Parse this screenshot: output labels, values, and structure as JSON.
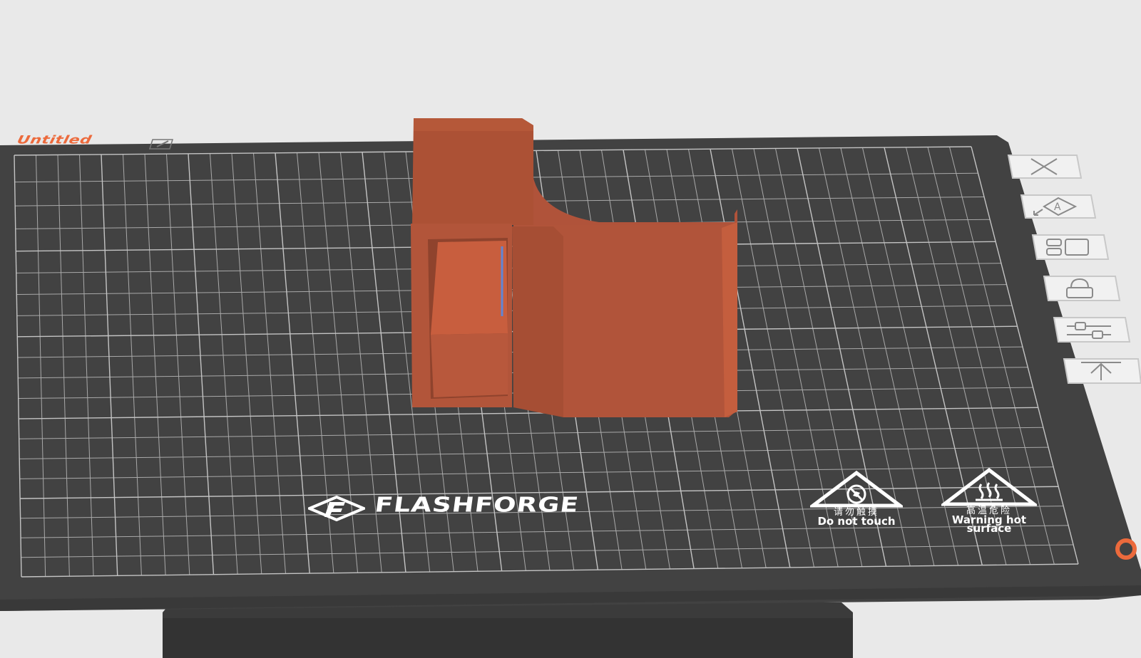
{
  "plate": {
    "title": "Untitled"
  },
  "brand": {
    "name": "FLASHFORGE"
  },
  "warnings": [
    {
      "icon": "no-touch-icon",
      "cn": "请勿触摸",
      "en": "Do not touch"
    },
    {
      "icon": "hot-surface-icon",
      "cn": "高温危险",
      "en": "Warning hot",
      "en2": "surface"
    }
  ],
  "side_tools": [
    "delete-plate-icon",
    "auto-orient-icon",
    "arrange-icon",
    "lock-plate-icon",
    "plate-settings-icon",
    "move-to-top-icon"
  ],
  "colors": {
    "bed": "#414141",
    "grid": "#a9a9a9",
    "model": "#b8563a",
    "accent": "#ec6a3c",
    "background": "#e9e9e9"
  }
}
